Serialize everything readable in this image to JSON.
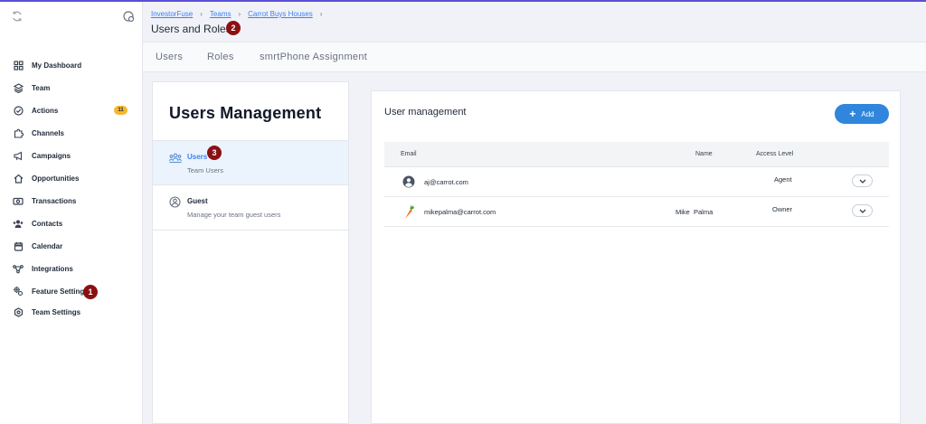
{
  "sidebar": {
    "items": [
      {
        "label": "My Dashboard",
        "icon": "dashboard-icon"
      },
      {
        "label": "Team",
        "icon": "layers-icon"
      },
      {
        "label": "Actions",
        "icon": "check-circle-icon",
        "badge": "11"
      },
      {
        "label": "Channels",
        "icon": "puzzle-icon"
      },
      {
        "label": "Campaigns",
        "icon": "megaphone-icon"
      },
      {
        "label": "Opportunities",
        "icon": "home-icon"
      },
      {
        "label": "Transactions",
        "icon": "money-icon"
      },
      {
        "label": "Contacts",
        "icon": "contacts-icon"
      },
      {
        "label": "Calendar",
        "icon": "calendar-icon"
      },
      {
        "label": "Integrations",
        "icon": "integrations-icon"
      },
      {
        "label": "Feature Settings",
        "icon": "gears-icon"
      },
      {
        "label": "Team Settings",
        "icon": "hexagon-gear-icon"
      }
    ]
  },
  "markers": {
    "one": "1",
    "two": "2",
    "three": "3"
  },
  "header": {
    "breadcrumbs": [
      "InvestorFuse",
      "Teams",
      "Carrot Buys Houses"
    ],
    "title": "Users and Roles"
  },
  "tabs": [
    "Users",
    "Roles",
    "smrtPhone Assignment"
  ],
  "management": {
    "title": "Users Management",
    "items": [
      {
        "title": "Users",
        "subtitle": "Team Users",
        "active": true
      },
      {
        "title": "Guest",
        "subtitle": "Manage your team guest users",
        "active": false
      }
    ]
  },
  "user_management": {
    "title": "User management",
    "add_label": "Add",
    "columns": {
      "email": "Email",
      "name": "Name",
      "access": "Access Level"
    },
    "rows": [
      {
        "email": "aj@carrot.com",
        "name": "",
        "access": "Agent",
        "avatar": "user-circle-icon"
      },
      {
        "email": "mikepalma@carrot.com",
        "name": "Mike  Palma",
        "access": "Owner",
        "avatar": "carrot-icon"
      }
    ]
  },
  "colors": {
    "accent": "#2f86dc",
    "badge": "#f5b82e",
    "marker": "#8b1012",
    "active_bg": "#ebf3fd"
  }
}
